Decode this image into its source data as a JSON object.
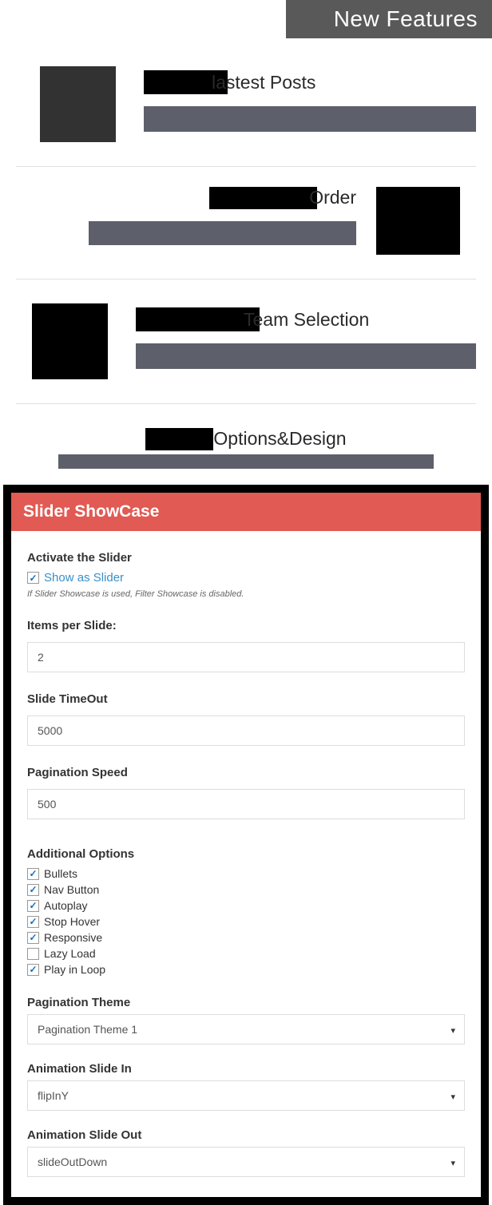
{
  "header": {
    "title": "New Features"
  },
  "features": {
    "lastest_posts": "lastest Posts",
    "order": "Order",
    "team_selection": "Team Selection",
    "options_design": "Options&Design"
  },
  "panel": {
    "title": "Slider ShowCase",
    "activate": {
      "label": "Activate the Slider",
      "checkbox_label": "Show as Slider",
      "helper": "If Slider Showcase is used, Filter Showcase is disabled."
    },
    "items_per_slide": {
      "label": "Items per Slide:",
      "value": "2"
    },
    "slide_timeout": {
      "label": "Slide TimeOut",
      "value": "5000"
    },
    "pagination_speed": {
      "label": "Pagination Speed",
      "value": "500"
    },
    "additional": {
      "label": "Additional Options",
      "options": [
        {
          "label": "Bullets",
          "checked": true
        },
        {
          "label": "Nav Button",
          "checked": true
        },
        {
          "label": "Autoplay",
          "checked": true
        },
        {
          "label": "Stop Hover",
          "checked": true
        },
        {
          "label": "Responsive",
          "checked": true
        },
        {
          "label": "Lazy Load",
          "checked": false
        },
        {
          "label": "Play in Loop",
          "checked": true
        }
      ]
    },
    "pagination_theme": {
      "label": "Pagination Theme",
      "value": "Pagination Theme 1"
    },
    "animation_in": {
      "label": "Animation Slide In",
      "value": "flipInY"
    },
    "animation_out": {
      "label": "Animation Slide Out",
      "value": "slideOutDown"
    }
  }
}
